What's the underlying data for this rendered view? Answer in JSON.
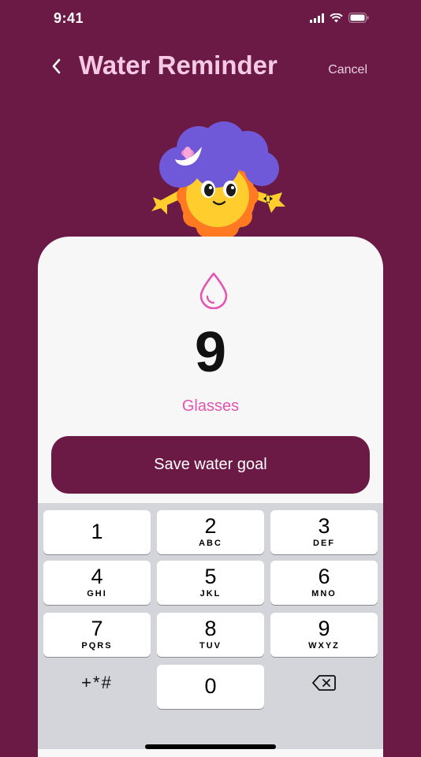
{
  "status_bar": {
    "time": "9:41"
  },
  "header": {
    "title": "Water Reminder",
    "cancel_label": "Cancel"
  },
  "goal": {
    "value": "9",
    "unit": "Glasses"
  },
  "save_button": {
    "label": "Save water goal"
  },
  "keypad": {
    "keys": [
      {
        "digit": "1",
        "letters": ""
      },
      {
        "digit": "2",
        "letters": "ABC"
      },
      {
        "digit": "3",
        "letters": "DEF"
      },
      {
        "digit": "4",
        "letters": "GHI"
      },
      {
        "digit": "5",
        "letters": "JKL"
      },
      {
        "digit": "6",
        "letters": "MNO"
      },
      {
        "digit": "7",
        "letters": "PQRS"
      },
      {
        "digit": "8",
        "letters": "TUV"
      },
      {
        "digit": "9",
        "letters": "WXYZ"
      },
      {
        "digit": "0",
        "letters": ""
      }
    ],
    "symbols_label": "+*#"
  },
  "colors": {
    "background": "#6b1a45",
    "accent": "#e455b1",
    "title": "#f6c9e5",
    "card": "#f7f7f7"
  },
  "icons": [
    "signal-icon",
    "wifi-icon",
    "battery-icon",
    "back-chevron-icon",
    "water-drop-icon",
    "delete-icon"
  ]
}
